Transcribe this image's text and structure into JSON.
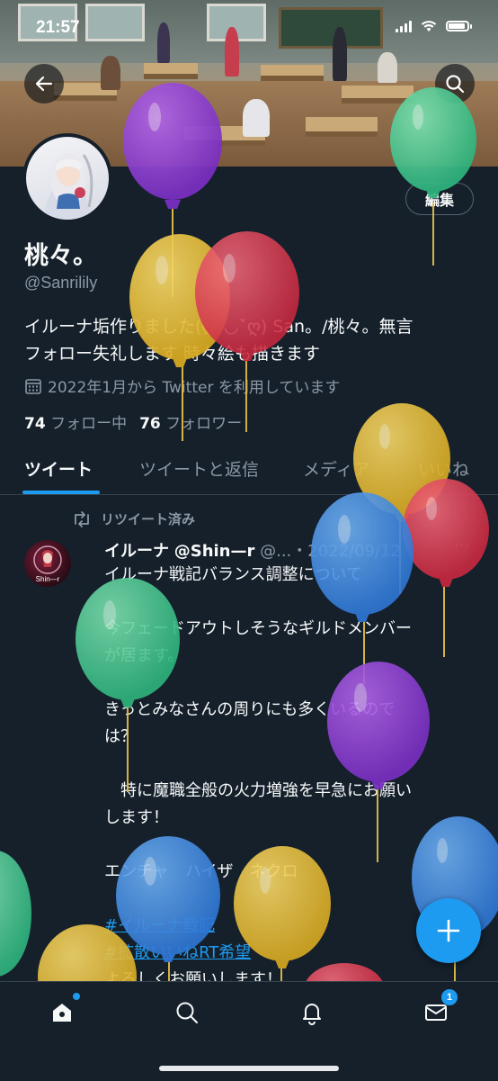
{
  "status_bar": {
    "time": "21:57"
  },
  "profile": {
    "name": "桃々。",
    "handle": "@Sanrilily",
    "edit_label": "編集",
    "bio_line1": "イルーナ垢作りました(ღˇ◡ˇღ) San。/桃々。無言",
    "bio_line2": "フォロー失礼します 時々絵も描きます",
    "joined": "2022年1月から Twitter を利用しています",
    "following_count": "74",
    "following_label": "フォロー中",
    "followers_count": "76",
    "followers_label": "フォロワー"
  },
  "tabs": [
    "ツイート",
    "ツイートと返信",
    "メディア",
    "いいね"
  ],
  "tweet": {
    "retweet_label": "リツイート済み",
    "author": "イルーナ",
    "author_handle": "@Shin—r",
    "meta": " @...・2022/09/12",
    "avatar_label": "Shin—r",
    "line1": "イルーナ戦記バランス調整について",
    "line2": "今フェードアウトしそうなギルドメンバー",
    "line3": "が居ます。",
    "line4": "きっとみなさんの周りにも多くいるので",
    "line5": "は？",
    "line6": "　特に魔職全般の火力増強を早急にお願い",
    "line7": "します！",
    "line8": "エンチャ　ハイザ　ネクロ",
    "hashtag1": "#イルーナ戦記",
    "hashtag2": "#拡散いいねRT希望",
    "line9": "よろしくお願いします！",
    "more": "···"
  },
  "bottom_nav": {
    "messages_badge": "1"
  },
  "icons": {
    "back": "arrow-left-icon",
    "search": "search-icon",
    "calendar": "calendar-icon",
    "retweet": "retweet-icon",
    "compose": "plus-icon",
    "home": "home-icon",
    "explore": "search-icon",
    "notifications": "bell-icon",
    "messages": "envelope-icon"
  },
  "colors": {
    "background": "#15202b",
    "accent": "#1d9bf0",
    "text_secondary": "#8b98a5",
    "divider": "#38444d"
  }
}
